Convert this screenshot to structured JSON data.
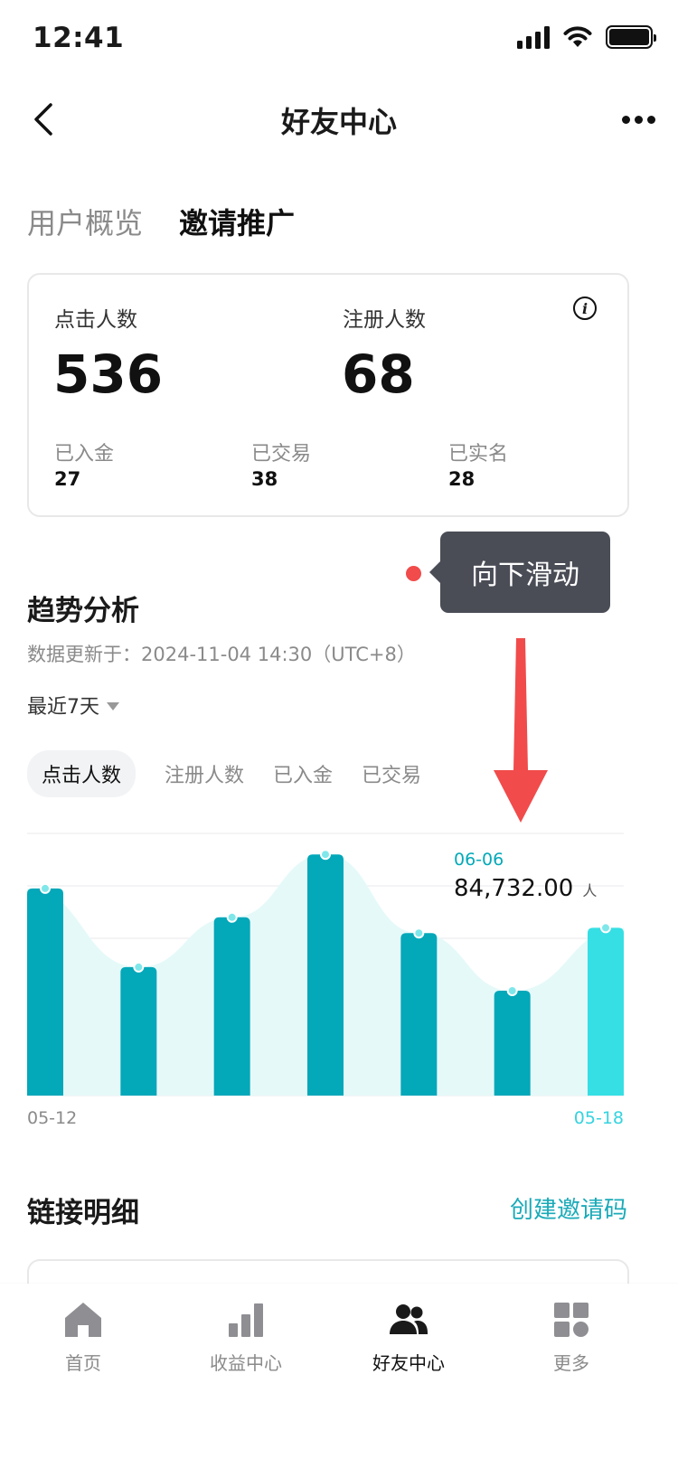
{
  "status_bar": {
    "time": "12:41"
  },
  "nav": {
    "title": "好友中心"
  },
  "tabs": [
    {
      "label": "用户概览",
      "active": false
    },
    {
      "label": "邀请推广",
      "active": true
    }
  ],
  "stats": {
    "clicks_label": "点击人数",
    "clicks_value": "536",
    "registered_label": "注册人数",
    "registered_value": "68",
    "deposited_label": "已入金",
    "deposited_value": "27",
    "traded_label": "已交易",
    "traded_value": "38",
    "verified_label": "已实名",
    "verified_value": "28"
  },
  "tooltip": {
    "text": "向下滑动"
  },
  "trend": {
    "title": "趋势分析",
    "update_time": "数据更新于：2024-11-04 14:30（UTC+8）",
    "range": "最近7天",
    "metric_tabs": [
      "点击人数",
      "注册人数",
      "已入金",
      "已交易"
    ],
    "tip_date": "06-06",
    "tip_value": "84,732.00",
    "tip_unit": "人",
    "x_start": "05-12",
    "x_end": "05-18"
  },
  "colors": {
    "bar": "#03a8b9",
    "bar_selected": "#35dfe4",
    "area": "#e6f9f9",
    "accent": "#1aaab8"
  },
  "chart_data": {
    "type": "bar",
    "categories": [
      "05-12",
      "",
      "",
      "",
      "",
      "",
      "05-18"
    ],
    "values": [
      79,
      49,
      68,
      92,
      62,
      40,
      64
    ],
    "ylim": [
      0,
      100
    ],
    "grid": true,
    "selected_index": 6
  },
  "links": {
    "title": "链接明细",
    "create_label": "创建邀请码"
  },
  "bottom_nav": [
    {
      "label": "首页",
      "icon": "home-icon",
      "active": false
    },
    {
      "label": "收益中心",
      "icon": "bar-chart-icon",
      "active": false
    },
    {
      "label": "好友中心",
      "icon": "friends-icon",
      "active": true
    },
    {
      "label": "更多",
      "icon": "grid-icon",
      "active": false
    }
  ]
}
